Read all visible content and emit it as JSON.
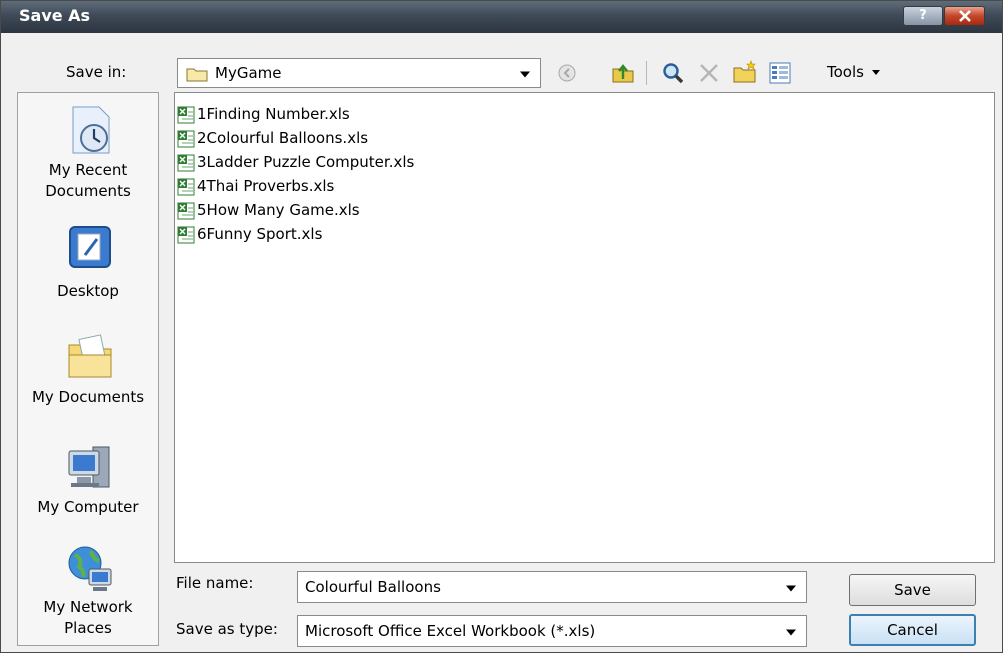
{
  "window": {
    "title": "Save As"
  },
  "toolbar": {
    "save_in_label": "Save in:",
    "current_folder": "MyGame",
    "tools_label": "Tools"
  },
  "places": [
    {
      "label": "My Recent Documents",
      "icon": "recent-documents-icon"
    },
    {
      "label": "Desktop",
      "icon": "desktop-icon"
    },
    {
      "label": "My Documents",
      "icon": "my-documents-icon"
    },
    {
      "label": "My Computer",
      "icon": "my-computer-icon"
    },
    {
      "label": "My Network Places",
      "icon": "network-places-icon"
    }
  ],
  "files": [
    {
      "name": "1Finding Number.xls"
    },
    {
      "name": "2Colourful Balloons.xls"
    },
    {
      "name": "3Ladder Puzzle Computer.xls"
    },
    {
      "name": "4Thai Proverbs.xls"
    },
    {
      "name": "5How Many Game.xls"
    },
    {
      "name": "6Funny Sport.xls"
    }
  ],
  "form": {
    "filename_label": "File name:",
    "filename_value": "Colourful Balloons",
    "filetype_label": "Save as type:",
    "filetype_value": "Microsoft Office Excel Workbook (*.xls)"
  },
  "buttons": {
    "save": "Save",
    "cancel": "Cancel"
  },
  "colors": {
    "titlebar": "#3f4a58",
    "excel_green": "#2e7d32",
    "default_button": "#3c7fb1"
  }
}
